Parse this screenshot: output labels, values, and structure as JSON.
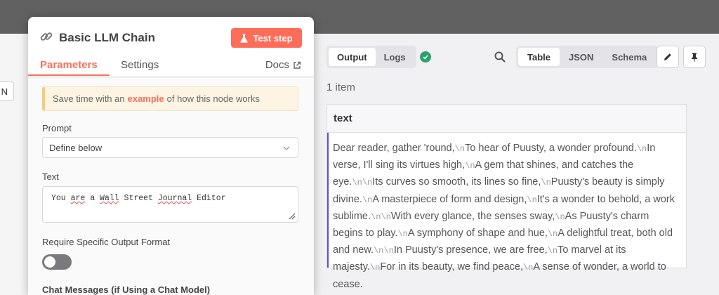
{
  "left_panel": {
    "input_value": "N"
  },
  "node": {
    "title": "Basic LLM Chain",
    "test_step_label": "Test step",
    "tabs": [
      {
        "label": "Parameters"
      },
      {
        "label": "Settings"
      }
    ],
    "docs_label": "Docs",
    "notice": {
      "prefix": "Save time with an",
      "link": "example",
      "suffix": "of how this node works"
    },
    "prompt": {
      "label": "Prompt",
      "value": "Define below"
    },
    "text": {
      "label": "Text",
      "value_parts": [
        "You ",
        "are",
        " a ",
        "Wall",
        " Street ",
        "Journal",
        " Editor"
      ]
    },
    "output_format": {
      "label": "Require Specific Output Format",
      "enabled": false
    },
    "chat_messages_label": "Chat Messages (if Using a Chat Model)"
  },
  "output": {
    "mode_tabs": [
      {
        "label": "Output"
      },
      {
        "label": "Logs"
      }
    ],
    "view_tabs": [
      {
        "label": "Table"
      },
      {
        "label": "JSON"
      },
      {
        "label": "Schema"
      }
    ],
    "item_count": "1 item",
    "column_header": "text",
    "newline_token": "\\n",
    "result_segments": [
      "Dear reader, gather 'round,",
      "To hear of Puusty, a wonder profound.",
      "In verse, I'll sing its virtues high,",
      "A gem that shines, and catches the eye.",
      "",
      "Its curves so smooth, its lines so fine,",
      "Puusty's beauty is simply divine.",
      "A masterpiece of form and design,",
      "It's a wonder to behold, a work sublime.",
      "",
      "With every glance, the senses sway,",
      "As Puusty's charm begins to play.",
      "A symphony of shape and hue,",
      "A delightful treat, both old and new.",
      "",
      "In Puusty's presence, we are free,",
      "To marvel at its majesty.",
      "For in its beauty, we find peace,",
      "A sense of wonder, a world to cease."
    ]
  },
  "colors": {
    "accent": "#ff6d5a",
    "success": "#29a36a",
    "result_border": "#5b4fd6"
  }
}
